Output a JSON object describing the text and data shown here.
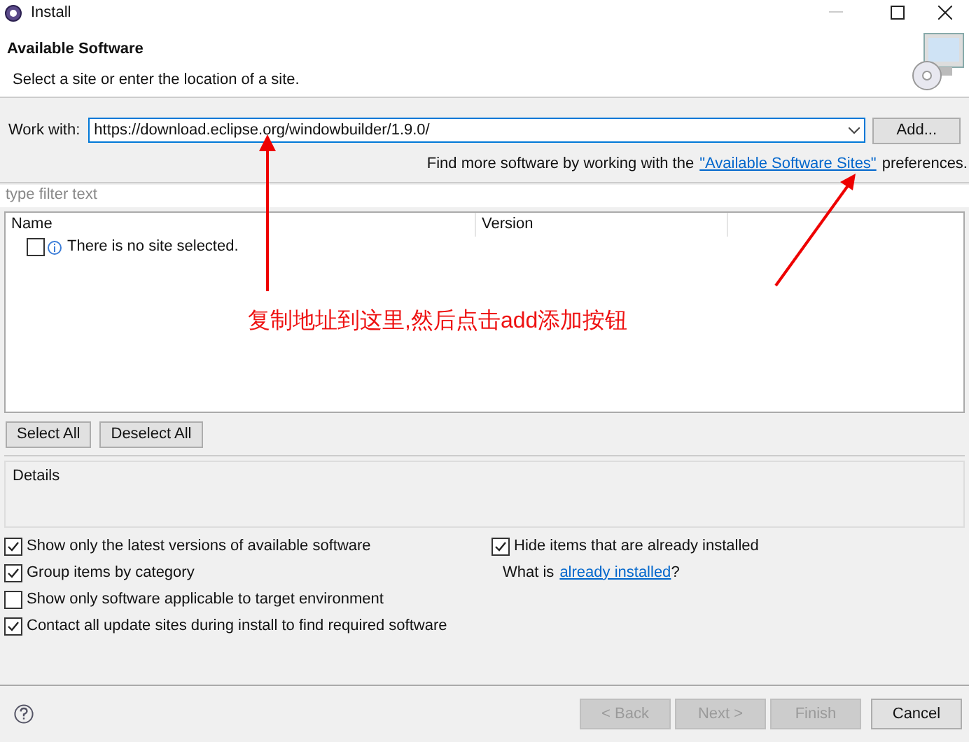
{
  "window": {
    "title": "Install"
  },
  "header": {
    "title": "Available Software",
    "subtitle": "Select a site or enter the location of a site."
  },
  "work_with": {
    "label": "Work with:",
    "value": "https://download.eclipse.org/windowbuilder/1.9.0/",
    "add_button": "Add..."
  },
  "find_more": {
    "before": "Find more software by working with the",
    "link": "\"Available Software Sites\"",
    "after": "preferences."
  },
  "filter": {
    "placeholder": "type filter text"
  },
  "table": {
    "columns": [
      "Name",
      "Version"
    ],
    "rows": [
      {
        "checked": false,
        "text": "There is no site selected."
      }
    ]
  },
  "selection_buttons": [
    "Select All",
    "Deselect All"
  ],
  "details": {
    "label": "Details"
  },
  "options_left": [
    {
      "label": "Show only the latest versions of available software",
      "checked": true
    },
    {
      "label": "Group items by category",
      "checked": true
    },
    {
      "label": "Show only software applicable to target environment",
      "checked": false
    },
    {
      "label": "Contact all update sites during install to find required software",
      "checked": true
    }
  ],
  "options_right": [
    {
      "label": "Hide items that are already installed",
      "checked": true
    }
  ],
  "what_is": {
    "before": "What is",
    "link": "already installed",
    "after": "?"
  },
  "footer_buttons": [
    {
      "label": "< Back",
      "disabled": true
    },
    {
      "label": "Next >",
      "disabled": true
    },
    {
      "label": "Finish",
      "disabled": true
    },
    {
      "label": "Cancel",
      "disabled": false
    }
  ],
  "annotation": {
    "text": "复制地址到这里,然后点击add添加按钮"
  }
}
